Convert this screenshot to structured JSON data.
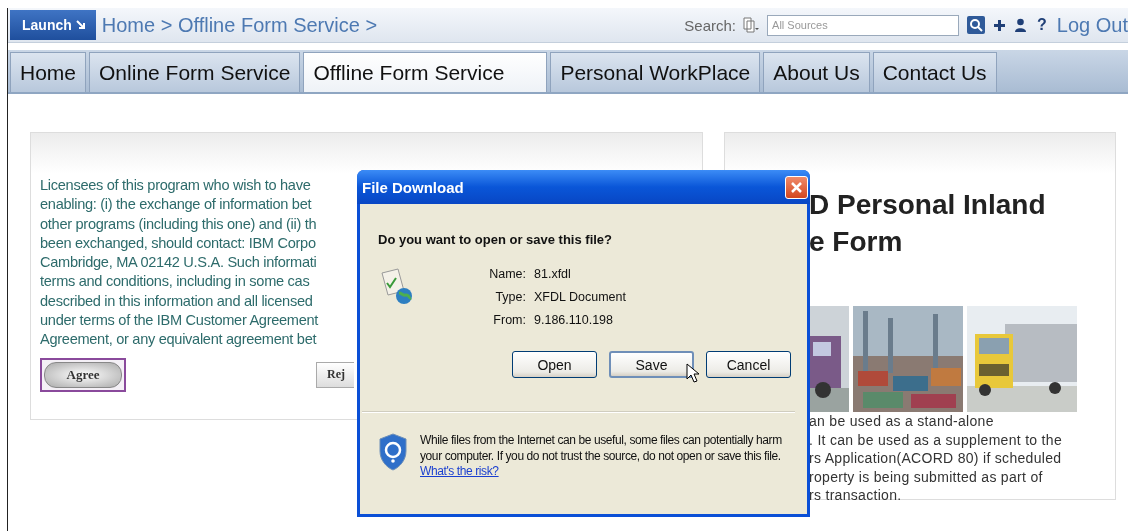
{
  "header": {
    "launch": "Launch",
    "breadcrumb": "Home > Offline Form Service >",
    "search_label": "Search:",
    "search_placeholder": "All Sources",
    "help": "?",
    "logout": "Log Out"
  },
  "tabs": [
    {
      "label": "Home",
      "selected": false
    },
    {
      "label": "Online Form Service",
      "selected": false
    },
    {
      "label": "Offline Form Service",
      "selected": true
    },
    {
      "label": "Personal WorkPlace",
      "selected": false
    },
    {
      "label": "About Us",
      "selected": false
    },
    {
      "label": "Contact Us",
      "selected": false
    }
  ],
  "license_card": {
    "lines": [
      "Licensees of this program who wish to have",
      "enabling: (i) the exchange of information bet",
      "other programs (including this one) and (ii) th",
      "been exchanged, should contact: IBM Corpo",
      "Cambridge, MA 02142 U.S.A. Such informati",
      "terms and conditions, including in some cas",
      "described in this information and all licensed",
      "under terms of the IBM Customer Agreement",
      "Agreement, or any equivalent agreement bet"
    ],
    "agree": "Agree",
    "reject": "Rej"
  },
  "form_card": {
    "title_lines": [
      "D Personal Inland",
      "e Form"
    ],
    "pictures": [
      {
        "kind": "picture"
      },
      {
        "kind": "picture"
      },
      {
        "kind": "picture"
      }
    ],
    "description_lines": [
      "an be used as a stand-alone",
      ". It can be used as a supplement to the",
      "rs Application(ACORD 80) if scheduled",
      "roperty is being submitted as part of",
      "rs transaction."
    ]
  },
  "dialog": {
    "title": "File Download",
    "question": "Do you want to open or save this file?",
    "details": [
      {
        "label": "Name:",
        "value": "81.xfdl"
      },
      {
        "label": "Type:",
        "value": "XFDL Document"
      },
      {
        "label": "From:",
        "value": "9.186.110.198"
      }
    ],
    "buttons": [
      {
        "label": "Open",
        "focused": false
      },
      {
        "label": "Save",
        "focused": true
      },
      {
        "label": "Cancel",
        "focused": false
      }
    ],
    "warning": "While files from the Internet can be useful, some files can potentially harm your computer. If you do not trust the source, do not open or save this file.",
    "link": "What's the risk?"
  }
}
